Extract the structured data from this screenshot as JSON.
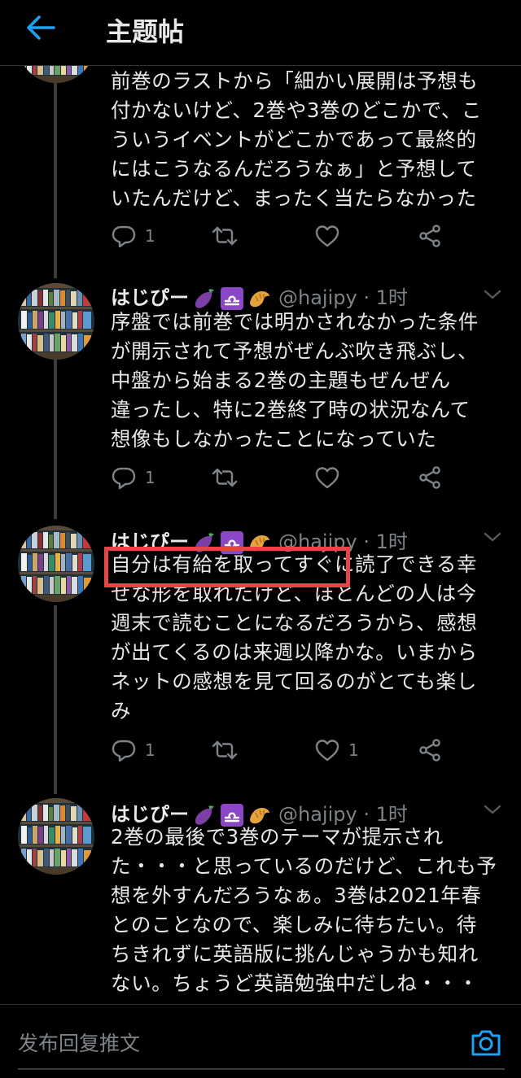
{
  "header": {
    "title": "主题帖"
  },
  "colors": {
    "accent": "#1da1f2",
    "highlight": "#e64545",
    "muted": "#7e8388"
  },
  "tweets": [
    {
      "text_lines": [
        "前巻のラストから「細かい展開は予想も",
        "付かないけど、2巻や3巻のどこかで、こ",
        "ういうイベントがどこかであって最終的",
        "にはこうなるんだろうなぁ」と予想して",
        "いたんだけど、まったく当たらなかった"
      ],
      "reply_count": "1"
    },
    {
      "name": "はじぴー",
      "handle": "@hajipy · 1时",
      "text_lines": [
        "序盤では前巻では明かされなかった条件",
        "が開示されて予想がぜんぶ吹き飛ぶし、",
        "中盤から始まる2巻の主題もぜんぜん",
        "違ったし、特に2巻終了時の状況なんて",
        "想像もしなかったことになっていた"
      ],
      "reply_count": "1"
    },
    {
      "name": "はじぴー",
      "handle": "@hajipy · 1时",
      "text_lines": [
        "自分は有給を取ってすぐに読了できる幸",
        "せな形を取れたけど、ほとんどの人は今",
        "週末で読むことになるだろうから、感想",
        "が出てくるのは来週以降かな。いまから",
        "ネットの感想を見て回るのがとても楽し",
        "み"
      ],
      "reply_count": "1",
      "like_count": "1"
    },
    {
      "name": "はじぴー",
      "handle": "@hajipy · 1时",
      "text_lines": [
        "2巻の最後で3巻のテーマが提示され",
        "た・・・と思っているのだけど、これも予",
        "想を外すんだろうなぁ。3巻は2021年春",
        "とのことなので、楽しみに待ちたい。待",
        "ちきれずに英語版に挑んじゃうかも知れ",
        "ない。ちょうど英語勉強中だしね・・・"
      ]
    }
  ],
  "composer": {
    "placeholder": "发布回复推文"
  },
  "icons": [
    "back-arrow-icon",
    "reply-icon",
    "retweet-icon",
    "like-icon",
    "share-icon",
    "chevron-down-icon",
    "camera-icon",
    "eggplant-emoji-icon",
    "libra-emoji-icon",
    "croissant-emoji-icon"
  ]
}
